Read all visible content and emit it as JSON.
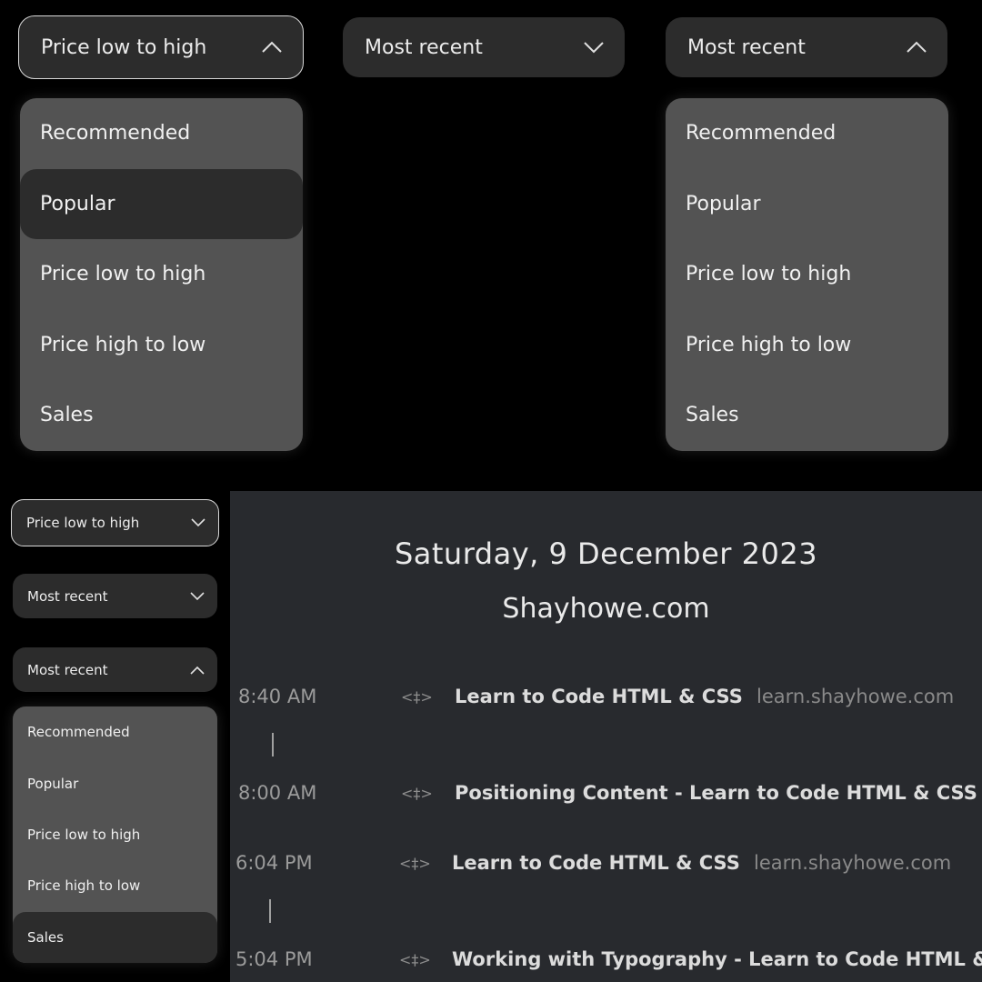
{
  "dropdown_a": {
    "selected": "Price low to high",
    "options": [
      "Recommended",
      "Popular",
      "Price low to high",
      "Price high to low",
      "Sales"
    ],
    "highlighted": "Popular"
  },
  "dropdown_b": {
    "selected": "Most recent"
  },
  "dropdown_c": {
    "selected": "Most recent",
    "options": [
      "Recommended",
      "Popular",
      "Price low to high",
      "Price high to low",
      "Sales"
    ]
  },
  "small": {
    "sel1": "Price low to high",
    "sel2": "Most recent",
    "sel3": "Most recent",
    "options": [
      "Recommended",
      "Popular",
      "Price low to high",
      "Price high to low",
      "Sales"
    ],
    "highlighted": "Sales"
  },
  "history": {
    "date": "Saturday, 9 December 2023",
    "site": "Shayhowe.com",
    "code_glyph": "<‡>",
    "entries": [
      {
        "time": "8:40 AM",
        "title": "Learn to Code HTML & CSS",
        "domain": "learn.shayhowe.com"
      },
      {
        "time": "8:00 AM",
        "title": "Positioning Content - Learn to Code HTML & CSS",
        "domain": ""
      },
      {
        "time": "6:04 PM",
        "title": "Learn to Code HTML & CSS",
        "domain": "learn.shayhowe.com"
      },
      {
        "time": "5:04 PM",
        "title": "Working with Typography - Learn to Code HTML & CSS",
        "domain": ""
      }
    ]
  }
}
